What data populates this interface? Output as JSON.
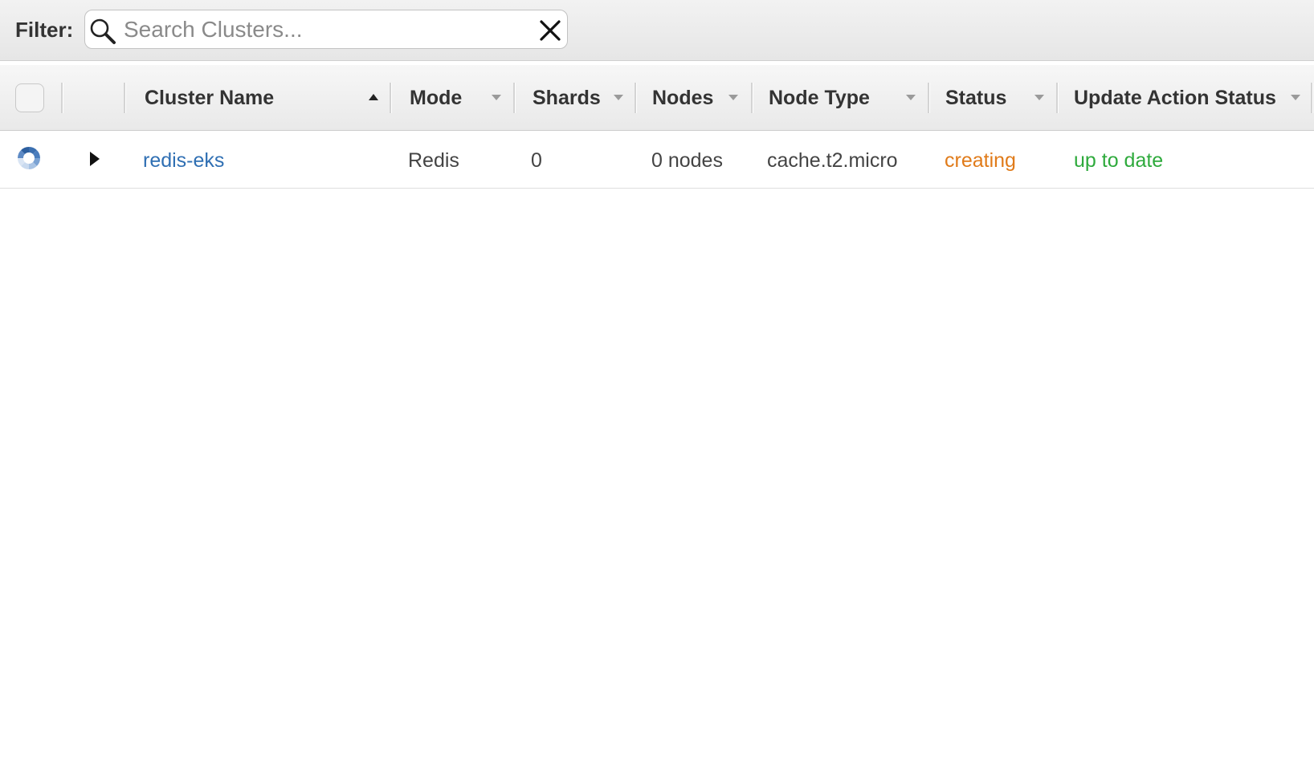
{
  "filter": {
    "label": "Filter:",
    "placeholder": "Search Clusters...",
    "value": ""
  },
  "table": {
    "columns": [
      {
        "label": "Cluster Name",
        "sort": "ascending"
      },
      {
        "label": "Mode",
        "sort": "none"
      },
      {
        "label": "Shards",
        "sort": "none"
      },
      {
        "label": "Nodes",
        "sort": "none"
      },
      {
        "label": "Node Type",
        "sort": "none"
      },
      {
        "label": "Status",
        "sort": "none"
      },
      {
        "label": "Update Action Status",
        "sort": "none"
      }
    ],
    "rows": [
      {
        "cluster_name": "redis-eks",
        "mode": "Redis",
        "shards": "0",
        "nodes": "0 nodes",
        "node_type": "cache.t2.micro",
        "status": "creating",
        "update_action_status": "up to date"
      }
    ]
  },
  "icons": {
    "search": "search-icon",
    "clear": "close-icon",
    "row_status": "spinner-icon",
    "expand": "caret-right-icon",
    "sort_asc": "sort-up-icon",
    "sort_menu": "caret-down-icon"
  },
  "colors": {
    "link": "#2f6fb3",
    "status_creating": "#e07b1a",
    "status_up_to_date": "#2eaa3c"
  }
}
